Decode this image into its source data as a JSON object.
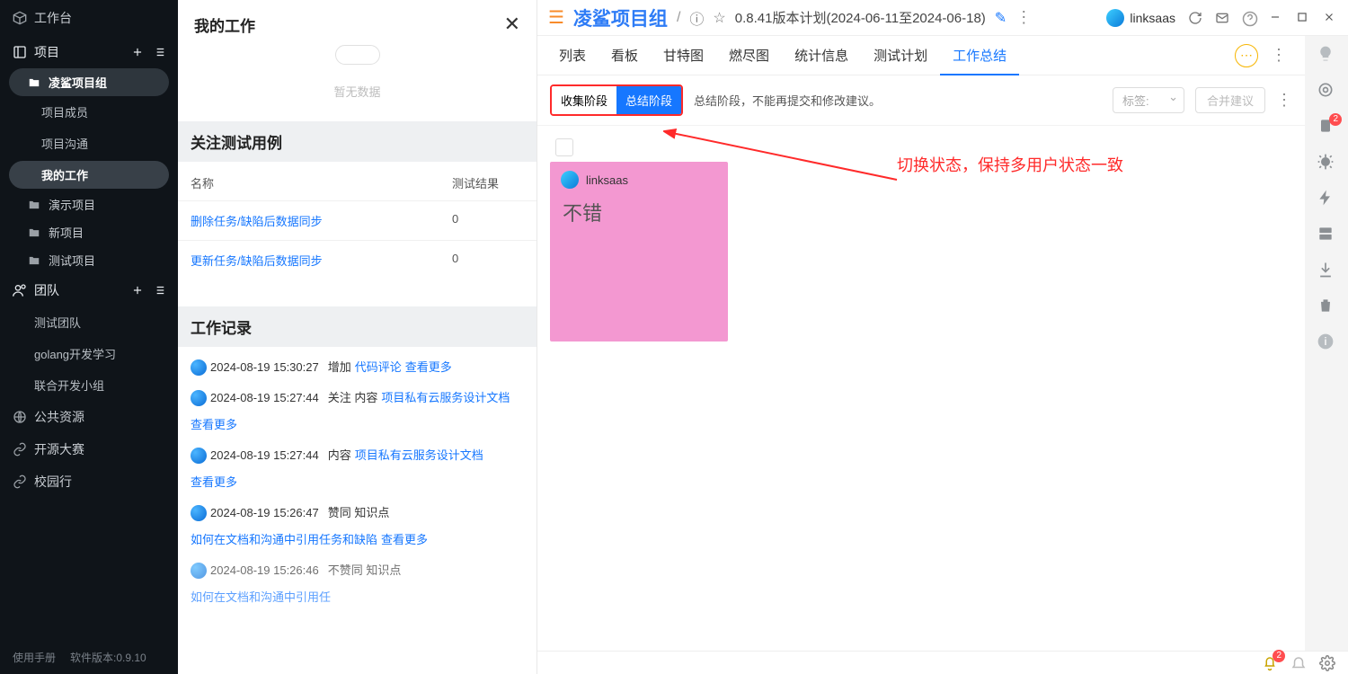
{
  "sidebar": {
    "workbench": "工作台",
    "project_header": "项目",
    "projects": [
      {
        "label": "凌鲨项目组",
        "active": true,
        "subs": [
          {
            "label": "项目成员"
          },
          {
            "label": "项目沟通"
          },
          {
            "label": "我的工作",
            "active": true
          }
        ]
      },
      {
        "label": "演示项目"
      },
      {
        "label": "新项目"
      },
      {
        "label": "测试项目"
      }
    ],
    "team_header": "团队",
    "teams": [
      "测试团队",
      "golang开发学习",
      "联合开发小组"
    ],
    "public_res": "公共资源",
    "open_contest": "开源大赛",
    "school_run": "校园行",
    "foot_manual": "使用手册",
    "foot_version": "软件版本:0.9.10"
  },
  "mywork": {
    "title": "我的工作",
    "empty": "暂无数据",
    "testcase_section": "关注测试用例",
    "col_name": "名称",
    "col_result": "测试结果",
    "testcases": [
      {
        "name": "删除任务/缺陷后数据同步",
        "result": "0"
      },
      {
        "name": "更新任务/缺陷后数据同步",
        "result": "0"
      }
    ],
    "worklog_section": "工作记录",
    "worklog": [
      {
        "time": "2024-08-19 15:30:27",
        "pre": "增加",
        "link1": "代码评论",
        "post": "",
        "link2": "查看更多"
      },
      {
        "time": "2024-08-19 15:27:44",
        "pre": "关注 内容",
        "link1": "项目私有云服务设计文档",
        "post": "",
        "link2": "查看更多"
      },
      {
        "time": "2024-08-19 15:27:44",
        "pre": "内容",
        "link1": "项目私有云服务设计文档",
        "post": "",
        "link2": "查看更多"
      },
      {
        "time": "2024-08-19 15:26:47",
        "pre": "赞同 知识点",
        "link1": "如何在文档和沟通中引用任务和缺陷",
        "post": "",
        "link2": "查看更多"
      },
      {
        "time": "2024-08-19 15:26:46",
        "pre": "不赞同 知识点",
        "link1": "如何在文档和沟通中引用任",
        "post": "",
        "link2": ""
      }
    ]
  },
  "topbar": {
    "project": "凌鲨项目组",
    "version": "0.8.41版本计划(2024-06-11至2024-06-18)",
    "user": "linksaas"
  },
  "tabs": {
    "list": [
      "列表",
      "看板",
      "甘特图",
      "燃尽图",
      "统计信息",
      "测试计划",
      "工作总结"
    ],
    "active_index": 6
  },
  "toolbar": {
    "phase_collect": "收集阶段",
    "phase_summary": "总结阶段",
    "note": "总结阶段，不能再提交和修改建议。",
    "tag_placeholder": "标签:",
    "merge_label": "合并建议"
  },
  "card": {
    "author": "linksaas",
    "text": "不错"
  },
  "annotation": "切换状态，保持多用户状态一致",
  "statusbar": {
    "badge": "2"
  },
  "rail_badge": "2"
}
